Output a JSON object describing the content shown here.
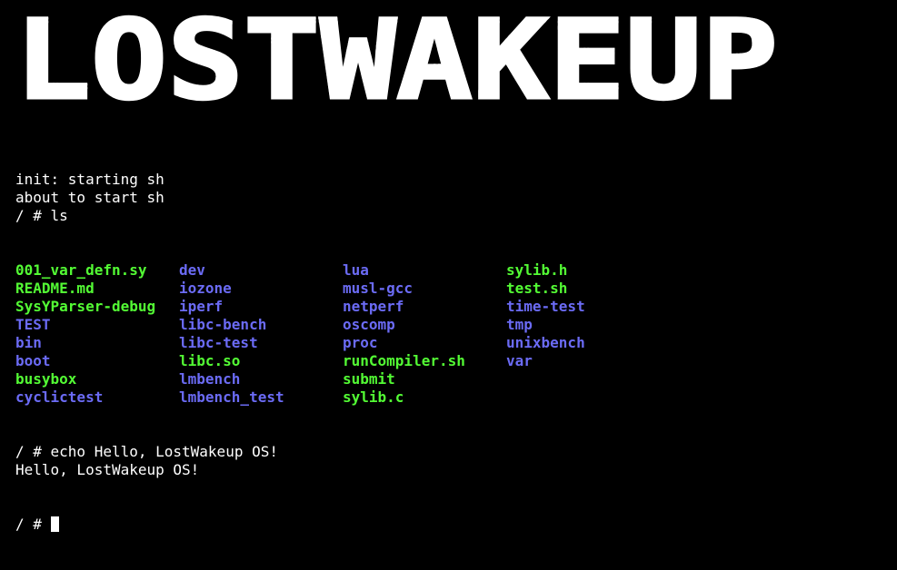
{
  "banner": {
    "text": "LOSTWAKEUP"
  },
  "colors": {
    "background": "#000000",
    "text": "#ffffff",
    "file": "#53fb34",
    "directory": "#6b6bf5"
  },
  "terminal": {
    "lines_before": [
      "init: starting sh",
      "about to start sh",
      "/ # ls"
    ],
    "ls_rows": [
      [
        {
          "name": "001_var_defn.sy",
          "kind": "file"
        },
        {
          "name": "dev",
          "kind": "directory"
        },
        {
          "name": "lua",
          "kind": "directory"
        },
        {
          "name": "sylib.h",
          "kind": "file"
        }
      ],
      [
        {
          "name": "README.md",
          "kind": "file"
        },
        {
          "name": "iozone",
          "kind": "directory"
        },
        {
          "name": "musl-gcc",
          "kind": "directory"
        },
        {
          "name": "test.sh",
          "kind": "file"
        }
      ],
      [
        {
          "name": "SysYParser-debug",
          "kind": "file"
        },
        {
          "name": "iperf",
          "kind": "directory"
        },
        {
          "name": "netperf",
          "kind": "directory"
        },
        {
          "name": "time-test",
          "kind": "directory"
        }
      ],
      [
        {
          "name": "TEST",
          "kind": "directory"
        },
        {
          "name": "libc-bench",
          "kind": "directory"
        },
        {
          "name": "oscomp",
          "kind": "directory"
        },
        {
          "name": "tmp",
          "kind": "directory"
        }
      ],
      [
        {
          "name": "bin",
          "kind": "directory"
        },
        {
          "name": "libc-test",
          "kind": "directory"
        },
        {
          "name": "proc",
          "kind": "directory"
        },
        {
          "name": "unixbench",
          "kind": "directory"
        }
      ],
      [
        {
          "name": "boot",
          "kind": "directory"
        },
        {
          "name": "libc.so",
          "kind": "file"
        },
        {
          "name": "runCompiler.sh",
          "kind": "file"
        },
        {
          "name": "var",
          "kind": "directory"
        }
      ],
      [
        {
          "name": "busybox",
          "kind": "file"
        },
        {
          "name": "lmbench",
          "kind": "directory"
        },
        {
          "name": "submit",
          "kind": "file"
        }
      ],
      [
        {
          "name": "cyclictest",
          "kind": "directory"
        },
        {
          "name": "lmbench_test",
          "kind": "directory"
        },
        {
          "name": "sylib.c",
          "kind": "file"
        }
      ]
    ],
    "lines_after": [
      "/ # echo Hello, LostWakeup OS!",
      "Hello, LostWakeup OS!"
    ],
    "prompt": "/ # "
  }
}
